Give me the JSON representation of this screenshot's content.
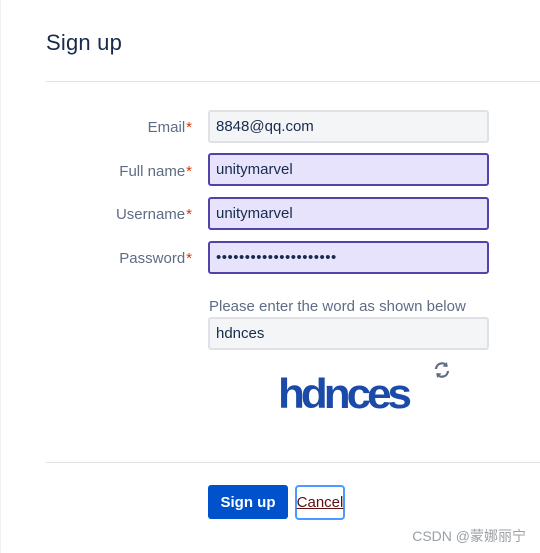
{
  "page": {
    "title": "Sign up"
  },
  "form": {
    "email": {
      "label": "Email",
      "required_mark": "*",
      "value": "8848@qq.com"
    },
    "fullname": {
      "label": "Full name",
      "required_mark": "*",
      "value": "unitymarvel"
    },
    "username": {
      "label": "Username",
      "required_mark": "*",
      "value": "unitymarvel"
    },
    "password": {
      "label": "Password",
      "required_mark": "*",
      "value": "•••••••••••••••••••••"
    },
    "captcha": {
      "hint": "Please enter the word as shown below",
      "value": "hdnces",
      "image_text": "hdnces",
      "refresh_icon": "refresh-icon"
    }
  },
  "actions": {
    "signup_label": "Sign up",
    "cancel_label": "Cancel"
  },
  "watermark": "CSDN @蒙娜丽宁",
  "colors": {
    "primary": "#0052cc",
    "autofill_bg": "#e8e3fc",
    "autofill_border": "#5243aa",
    "required": "#de350b",
    "captcha_text": "#1c4aa8"
  }
}
